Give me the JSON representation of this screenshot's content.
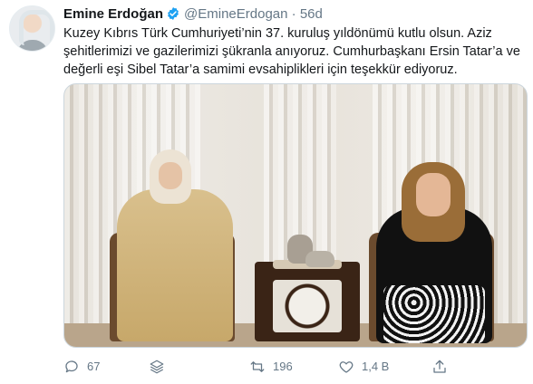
{
  "tweet": {
    "author_name": "Emine Erdoğan",
    "author_handle": "@EmineErdogan",
    "separator": "·",
    "time": "56d",
    "text": "Kuzey Kıbrıs Türk Cumhuriyeti’nin 37. kuruluş yıldönümü kutlu olsun. Aziz şehitlerimizi ve gazilerimizi şükranla anıyoruz. Cumhurbaşkanı Ersin Tatar’a ve değerli eşi Sibel Tatar’a samimi evsahiplikleri için teşekkür ediyoruz."
  },
  "actions": {
    "reply_count": "67",
    "retweet_count": "196",
    "like_count": "1,4 B"
  },
  "icons": {
    "verified": "verified-badge-icon",
    "reply": "reply-icon",
    "thread": "stack-icon",
    "retweet": "retweet-icon",
    "like": "heart-icon",
    "share": "share-icon"
  },
  "colors": {
    "accent": "#1da1f2",
    "text": "#14171a",
    "muted": "#657786",
    "border": "#ccd6dd"
  }
}
